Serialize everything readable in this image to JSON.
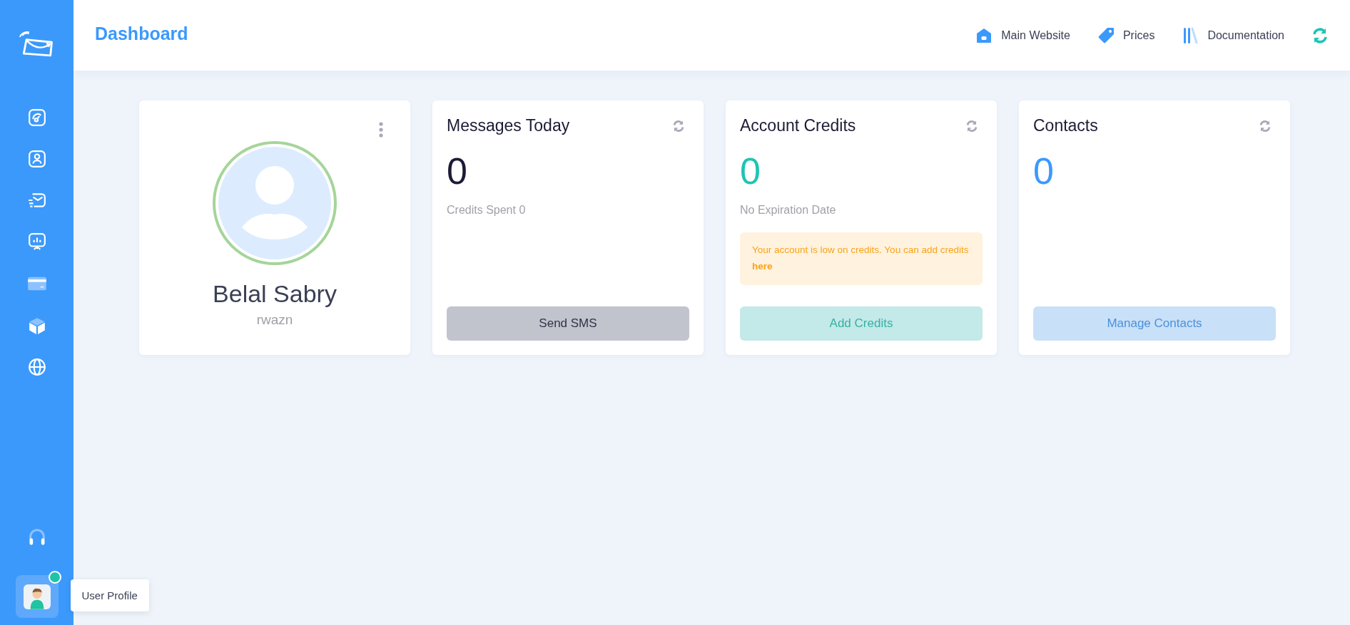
{
  "header": {
    "title": "Dashboard",
    "links": [
      {
        "label": "Main Website",
        "kind": "home"
      },
      {
        "label": "Prices",
        "kind": "tag"
      },
      {
        "label": "Documentation",
        "kind": "books"
      }
    ]
  },
  "profile": {
    "name": "Belal Sabry",
    "username": "rwazn"
  },
  "cards": [
    {
      "title": "Messages Today",
      "value": "0",
      "color": "#1b1b35",
      "subtitle": "Credits Spent 0",
      "button": "Send SMS"
    },
    {
      "title": "Account Credits",
      "value": "0",
      "color": "#1fc4b3",
      "subtitle": "No Expiration Date",
      "alert": {
        "text": "Your account is low on credits. You can add credits",
        "link": "here"
      },
      "button": "Add Credits"
    },
    {
      "title": "Contacts",
      "value": "0",
      "color": "#3b99fc",
      "button": "Manage Contacts"
    }
  ],
  "user": {
    "online": true,
    "tooltip": "User Profile"
  }
}
